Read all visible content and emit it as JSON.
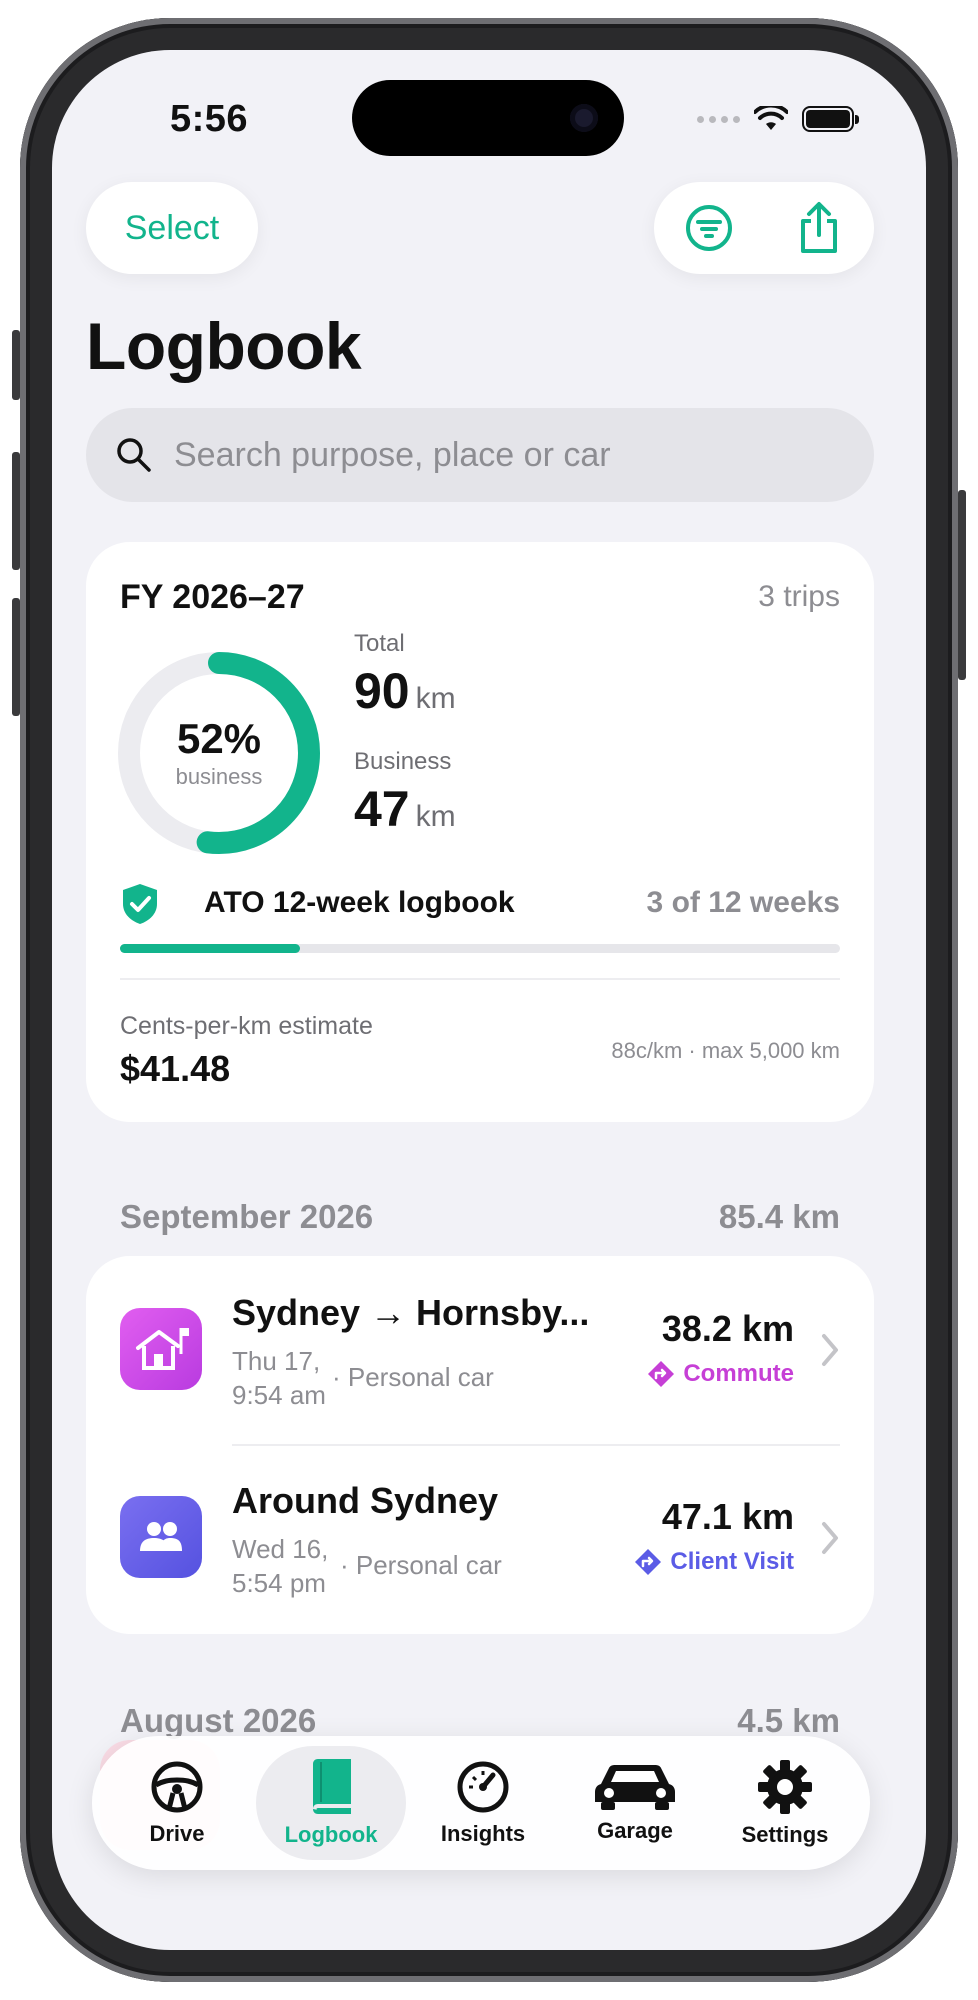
{
  "status": {
    "time": "5:56"
  },
  "toolbar": {
    "select_label": "Select",
    "filter_icon": "filter-icon",
    "share_icon": "share-icon"
  },
  "page": {
    "title": "Logbook"
  },
  "search": {
    "placeholder": "Search purpose, place or car"
  },
  "summary": {
    "fy": "FY 2026–27",
    "trips_count": "3 trips",
    "business_pct": "52%",
    "business_pct_value": 0.52,
    "business_sub": "business",
    "total_label": "Total",
    "total_value": "90",
    "total_unit": "km",
    "business_label": "Business",
    "business_value": "47",
    "business_unit": "km",
    "ato_label": "ATO 12-week logbook",
    "ato_weeks": "3 of 12 weeks",
    "ato_progress": 0.25,
    "cpk_label": "Cents-per-km estimate",
    "cpk_value": "$41.48",
    "cpk_note": "88c/km · max 5,000 km",
    "accent": "#12b48c"
  },
  "sections": [
    {
      "month": "September 2026",
      "total": "85.4 km",
      "trips": [
        {
          "title": "Sydney → Hornsby...",
          "date_line1": "Thu 17,",
          "date_line2": "9:54 am",
          "car": "· Personal car",
          "distance": "38.2 km",
          "tag": "Commute",
          "tag_color": "#c63fd6",
          "icon": "home-flag-icon",
          "icon_bg": "#d04ce0"
        },
        {
          "title": "Around Sydney",
          "date_line1": "Wed 16,",
          "date_line2": "5:54 pm",
          "car": "· Personal car",
          "distance": "47.1 km",
          "tag": "Client Visit",
          "tag_color": "#5b5ce6",
          "icon": "people-icon",
          "icon_bg": "#6663e8"
        }
      ]
    },
    {
      "month": "August 2026",
      "total": "4.5 km"
    }
  ],
  "tabbar": {
    "tabs": [
      {
        "label": "Drive",
        "icon": "steering-wheel-icon"
      },
      {
        "label": "Logbook",
        "icon": "book-icon",
        "active": true
      },
      {
        "label": "Insights",
        "icon": "speedometer-icon"
      },
      {
        "label": "Garage",
        "icon": "car-icon"
      },
      {
        "label": "Settings",
        "icon": "gear-icon"
      }
    ]
  }
}
